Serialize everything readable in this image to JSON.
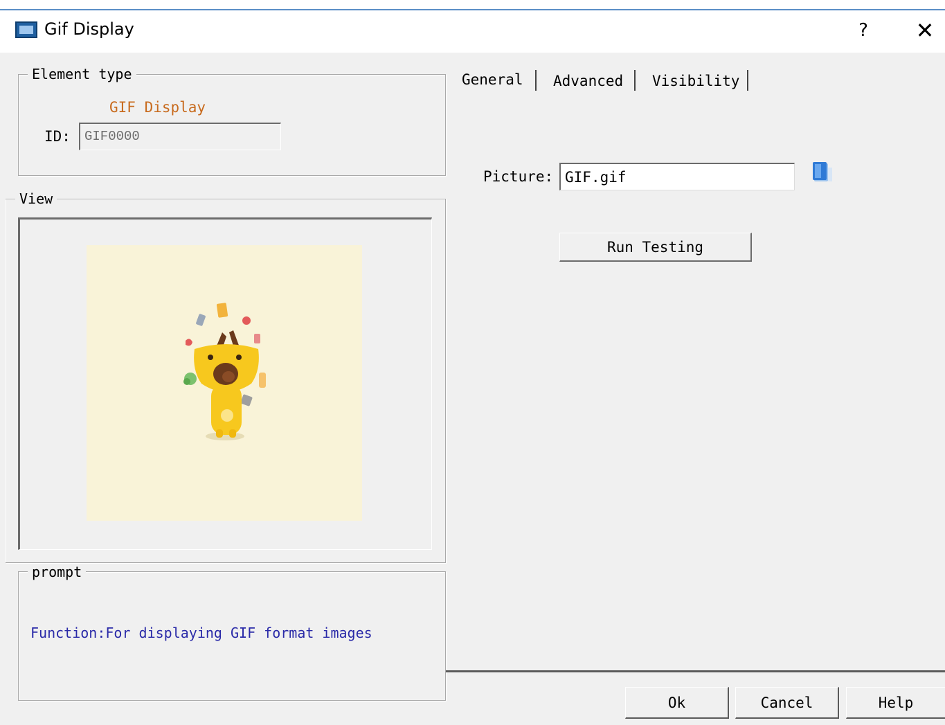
{
  "window": {
    "title": "Gif Display",
    "help_glyph": "?",
    "close_glyph": "✕",
    "app_icon": "hmi-monitor-icon"
  },
  "element_type": {
    "legend": "Element type",
    "type_name": "GIF Display",
    "id_label": "ID:",
    "id_value": "GIF0000"
  },
  "view": {
    "legend": "View",
    "preview_background": "#f9f3d8"
  },
  "prompt": {
    "legend": "prompt",
    "text": "Function:For displaying GIF format images"
  },
  "tabs": [
    {
      "label": "General",
      "active": true
    },
    {
      "label": "Advanced",
      "active": false
    },
    {
      "label": "Visibility",
      "active": false
    }
  ],
  "general": {
    "picture_label": "Picture:",
    "picture_value": "GIF.gif",
    "browse_icon": "folder-browse-icon",
    "run_testing_label": "Run Testing"
  },
  "buttons": {
    "ok": "Ok",
    "cancel": "Cancel",
    "help": "Help"
  },
  "colors": {
    "type_name": "#c86b1e",
    "prompt_text": "#2a2aa8",
    "title_accent": "#5b8fc7"
  }
}
